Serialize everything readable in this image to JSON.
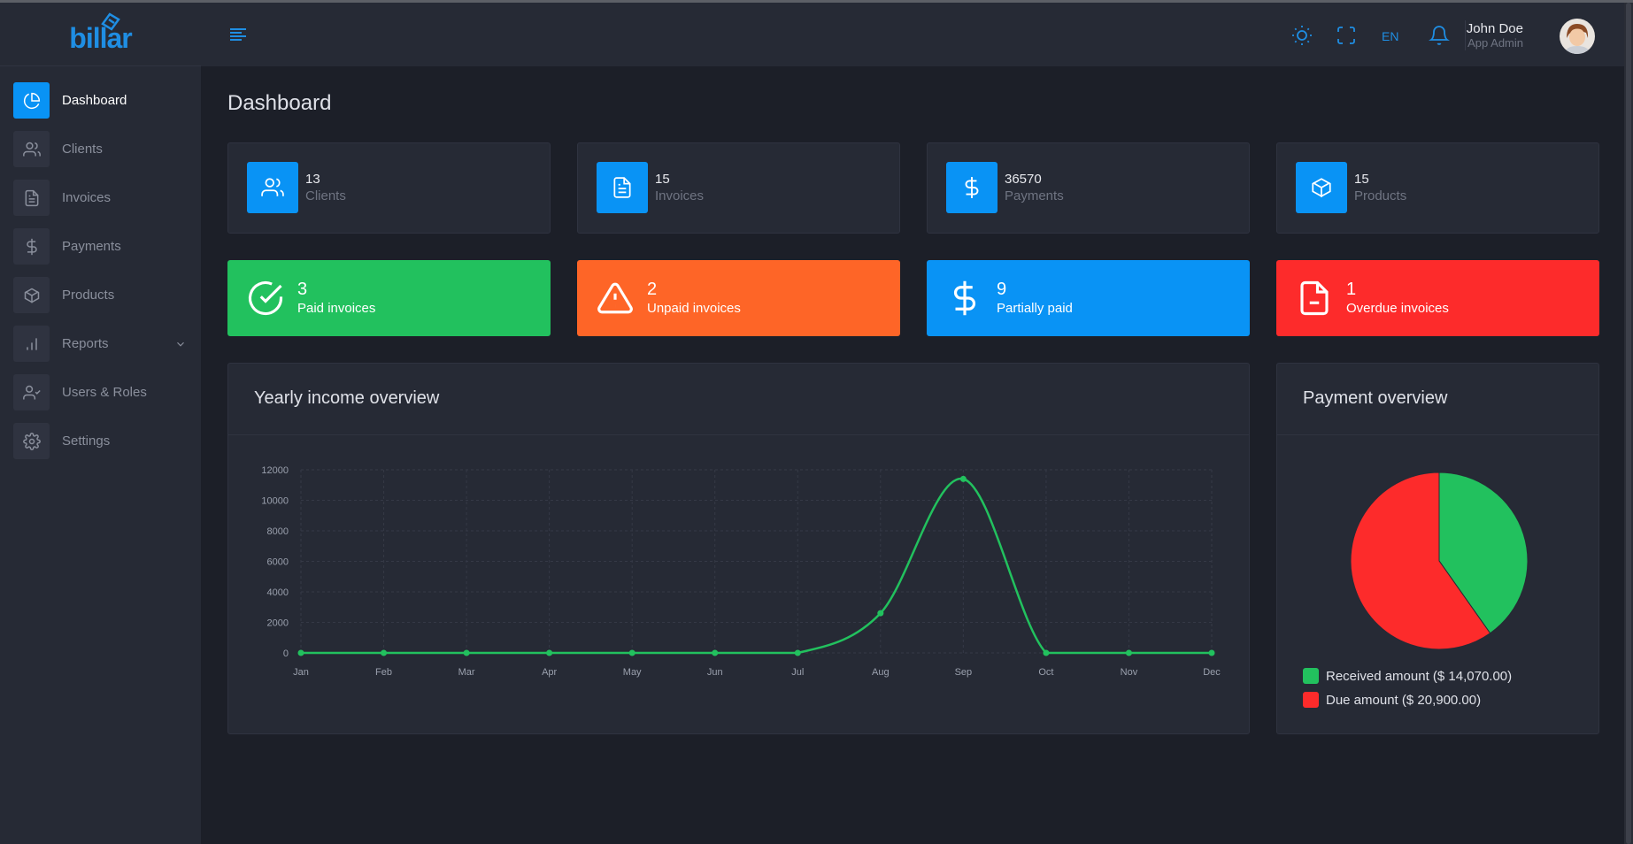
{
  "app": {
    "logo": "billar"
  },
  "sidebar": {
    "items": [
      {
        "label": "Dashboard",
        "icon": "dashboard-icon",
        "active": true
      },
      {
        "label": "Clients",
        "icon": "users-icon"
      },
      {
        "label": "Invoices",
        "icon": "document-icon"
      },
      {
        "label": "Payments",
        "icon": "dollar-icon"
      },
      {
        "label": "Products",
        "icon": "box-icon"
      },
      {
        "label": "Reports",
        "icon": "bar-chart-icon"
      },
      {
        "label": "Users & Roles",
        "icon": "user-check-icon"
      },
      {
        "label": "Settings",
        "icon": "gear-icon"
      }
    ]
  },
  "header": {
    "language": "EN",
    "user_name": "John Doe",
    "user_role": "App Admin"
  },
  "page": {
    "title": "Dashboard"
  },
  "stats": [
    {
      "value": "13",
      "label": "Clients",
      "icon": "users-icon"
    },
    {
      "value": "15",
      "label": "Invoices",
      "icon": "document-icon"
    },
    {
      "value": "36570",
      "label": "Payments",
      "icon": "dollar-icon"
    },
    {
      "value": "15",
      "label": "Products",
      "icon": "box-icon"
    }
  ],
  "invoice_status": [
    {
      "value": "3",
      "label": "Paid invoices",
      "color": "#22c15e",
      "icon": "check-circle-icon"
    },
    {
      "value": "2",
      "label": "Unpaid invoices",
      "color": "#fe6527",
      "icon": "warning-icon"
    },
    {
      "value": "9",
      "label": "Partially paid",
      "color": "#0993f5",
      "icon": "dollar-icon"
    },
    {
      "value": "1",
      "label": "Overdue invoices",
      "color": "#fd2b2b",
      "icon": "file-minus-icon"
    }
  ],
  "income_card": {
    "title": "Yearly income overview"
  },
  "payment_card": {
    "title": "Payment overview",
    "legend": [
      {
        "label": "Received amount ($ 14,070.00)",
        "color": "#22c15e"
      },
      {
        "label": "Due amount ($ 20,900.00)",
        "color": "#fd2b2b"
      }
    ]
  },
  "chart_data": [
    {
      "type": "line",
      "title": "Yearly income overview",
      "categories": [
        "Jan",
        "Feb",
        "Mar",
        "Apr",
        "May",
        "Jun",
        "Jul",
        "Aug",
        "Sep",
        "Oct",
        "Nov",
        "Dec"
      ],
      "values": [
        0,
        0,
        0,
        0,
        0,
        0,
        0,
        2600,
        11400,
        0,
        0,
        0
      ],
      "ylim": [
        0,
        12000
      ],
      "yticks": [
        0,
        2000,
        4000,
        6000,
        8000,
        10000,
        12000
      ],
      "color": "#22c15e",
      "grid": true
    },
    {
      "type": "pie",
      "title": "Payment overview",
      "labels": [
        "Received amount",
        "Due amount"
      ],
      "values": [
        14070,
        20900
      ],
      "colors": [
        "#22c15e",
        "#fd2b2b"
      ]
    }
  ]
}
